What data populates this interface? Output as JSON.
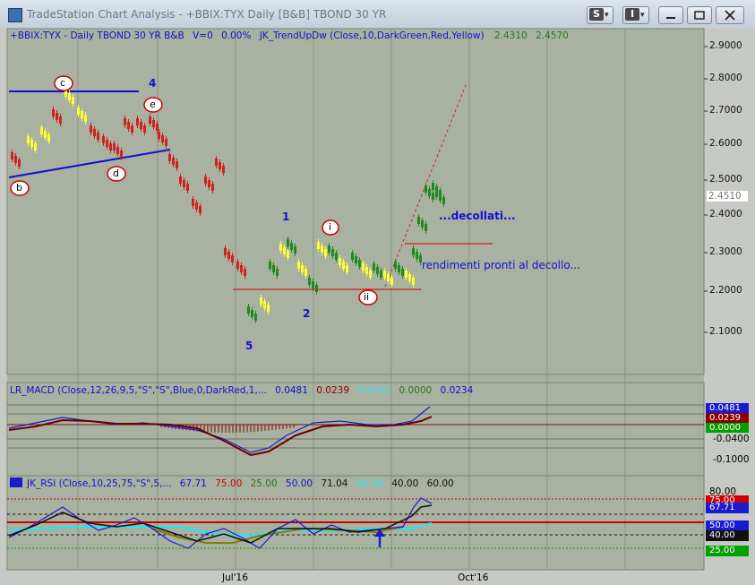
{
  "window": {
    "title": "TradeStation Chart Analysis - +BBIX:TYX Daily [B&B] TBOND 30 YR",
    "buttons": [
      {
        "label": "S",
        "arrow": "▾"
      },
      {
        "label": "I",
        "arrow": "▾"
      }
    ]
  },
  "header": {
    "symbol": "+BBIX:TYX - Daily  TBOND 30 YR  B&B",
    "volume": "V=0",
    "change": "0.00%",
    "indicator": "JK_TrendUpDw (Close,10,DarkGreen,Red,Yellow)",
    "val1": "2.4310",
    "val2": "2.4570"
  },
  "price_axis": {
    "labels": [
      "2.9000",
      "2.8000",
      "2.7000",
      "2.6000",
      "2.5000",
      "2.4000",
      "2.3000",
      "2.2000",
      "2.1000"
    ],
    "current": "2.4510"
  },
  "time_axis": {
    "labels": [
      "Jul'16",
      "Oct'16"
    ]
  },
  "annotations": {
    "c": "c",
    "e": "e",
    "b": "b",
    "d": "d",
    "i": "i",
    "ii": "ii",
    "w4": "4",
    "w1": "1",
    "w2": "2",
    "w5": "5",
    "decollati": "...decollati...",
    "rendimenti": "rendimenti pronti al decollo..."
  },
  "macd": {
    "title": "LR_MACD (Close,12,26,9,5,\"S\",\"S\",Blue,0,DarkRed,1,...",
    "v1": "0.0481",
    "v2": "0.0239",
    "v3": "0.0241",
    "v4": "0.0000",
    "v5": "0.0234",
    "axis_labels": [
      "-0.0400",
      "-0.1000"
    ],
    "tags": [
      {
        "text": "0.0481",
        "bg": "#1a1ad0"
      },
      {
        "text": "0.0239",
        "bg": "#8b0000"
      },
      {
        "text": "0.0000",
        "bg": "#00a000"
      }
    ]
  },
  "rsi": {
    "title": "JK_RSI (Close,10,25,75,\"S\",5,...",
    "v1": "67.71",
    "v2": "75.00",
    "v3": "25.00",
    "v4": "50.00",
    "v5": "71.04",
    "v6": "64.69",
    "v7": "40.00",
    "v8": "60.00",
    "axis_top": "80.00",
    "tags": [
      {
        "text": "75.00",
        "bg": "#cc0000"
      },
      {
        "text": "67.71",
        "bg": "#1a1ad0"
      },
      {
        "text": "50.00",
        "bg": "#1a1ad0"
      },
      {
        "text": "40.00",
        "bg": "#111111"
      },
      {
        "text": "25.00",
        "bg": "#00a000"
      }
    ]
  },
  "colors": {
    "up": "#1f8a1f",
    "down": "#d02020",
    "neutral": "#ffff30",
    "trend": "#1010d0"
  }
}
